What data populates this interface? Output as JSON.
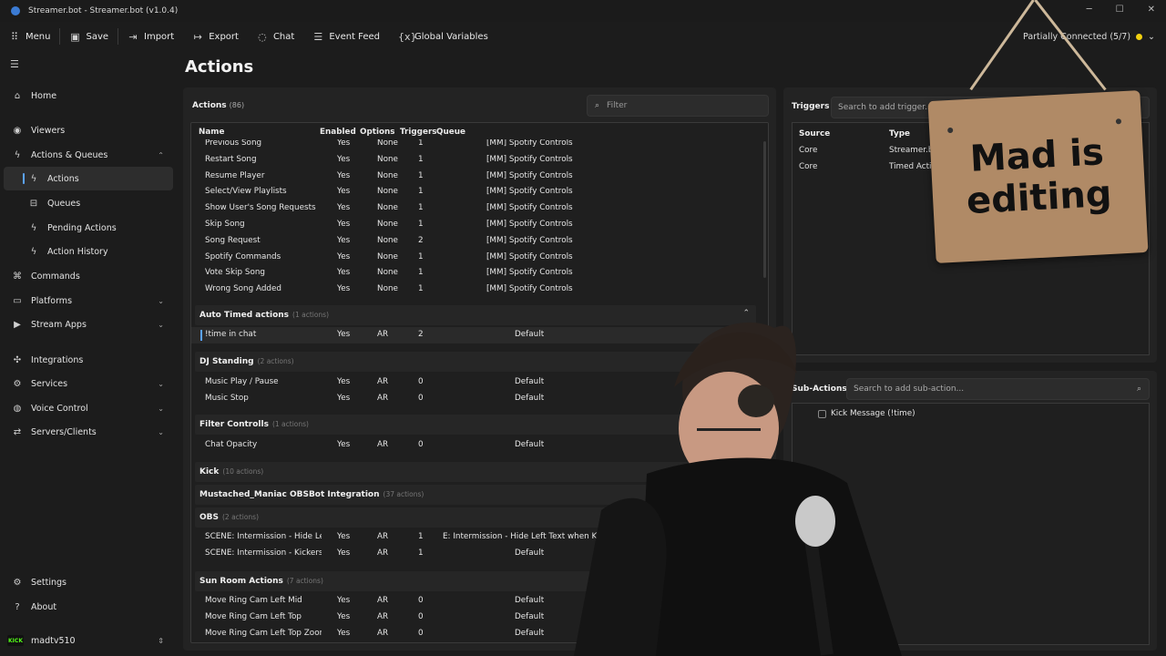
{
  "window": {
    "title": "Streamer.bot - Streamer.bot (v1.0.4)"
  },
  "toolbar": {
    "items": [
      {
        "label": "Menu",
        "icon": "grid-icon"
      },
      {
        "label": "Save",
        "icon": "save-icon"
      },
      {
        "label": "Import",
        "icon": "import-icon"
      },
      {
        "label": "Export",
        "icon": "export-icon"
      },
      {
        "label": "Chat",
        "icon": "chat-icon"
      },
      {
        "label": "Event Feed",
        "icon": "event-feed-icon"
      },
      {
        "label": "Global Variables",
        "icon": "variables-icon"
      }
    ],
    "connection_status": "Partially Connected (5/7)",
    "connection_color": "#f2d00f"
  },
  "sidebar": {
    "items": [
      {
        "label": "Home"
      },
      {
        "label": "Viewers"
      },
      {
        "label": "Actions & Queues"
      },
      {
        "label": "Actions"
      },
      {
        "label": "Queues"
      },
      {
        "label": "Pending Actions"
      },
      {
        "label": "Action History"
      },
      {
        "label": "Commands"
      },
      {
        "label": "Platforms"
      },
      {
        "label": "Stream Apps"
      },
      {
        "label": "Integrations"
      },
      {
        "label": "Services"
      },
      {
        "label": "Voice Control"
      },
      {
        "label": "Servers/Clients"
      },
      {
        "label": "Settings"
      },
      {
        "label": "About"
      }
    ],
    "user": {
      "platform": "KICK",
      "name": "madtv510"
    }
  },
  "page": {
    "title": "Actions"
  },
  "actions": {
    "heading": "Actions",
    "count": "(86)",
    "filter_placeholder": "Filter",
    "columns": [
      "Name",
      "Enabled",
      "Options",
      "Triggers",
      "Queue"
    ],
    "spotify_rows": [
      {
        "name": "Previous Song",
        "enabled": "Yes",
        "options": "None",
        "triggers": "1",
        "queue": "[MM] Spotify Controls"
      },
      {
        "name": "Restart Song",
        "enabled": "Yes",
        "options": "None",
        "triggers": "1",
        "queue": "[MM] Spotify Controls"
      },
      {
        "name": "Resume Player",
        "enabled": "Yes",
        "options": "None",
        "triggers": "1",
        "queue": "[MM] Spotify Controls"
      },
      {
        "name": "Select/View Playlists",
        "enabled": "Yes",
        "options": "None",
        "triggers": "1",
        "queue": "[MM] Spotify Controls"
      },
      {
        "name": "Show User's Song Requests",
        "enabled": "Yes",
        "options": "None",
        "triggers": "1",
        "queue": "[MM] Spotify Controls"
      },
      {
        "name": "Skip Song",
        "enabled": "Yes",
        "options": "None",
        "triggers": "1",
        "queue": "[MM] Spotify Controls"
      },
      {
        "name": "Song Request",
        "enabled": "Yes",
        "options": "None",
        "triggers": "2",
        "queue": "[MM] Spotify Controls"
      },
      {
        "name": "Spotify Commands",
        "enabled": "Yes",
        "options": "None",
        "triggers": "1",
        "queue": "[MM] Spotify Controls"
      },
      {
        "name": "Vote Skip Song",
        "enabled": "Yes",
        "options": "None",
        "triggers": "1",
        "queue": "[MM] Spotify Controls"
      },
      {
        "name": "Wrong Song Added",
        "enabled": "Yes",
        "options": "None",
        "triggers": "1",
        "queue": "[MM] Spotify Controls"
      }
    ],
    "groups": {
      "auto_timed": {
        "name": "Auto Timed actions",
        "count": "(1 actions)"
      },
      "dj_standing": {
        "name": "DJ Standing",
        "count": "(2 actions)"
      },
      "filter_controlls": {
        "name": "Filter Controlls",
        "count": "(1 actions)"
      },
      "kick": {
        "name": "Kick",
        "count": "(10 actions)"
      },
      "obsbot": {
        "name": "Mustached_Maniac OBSBot Integration",
        "count": "(37 actions)"
      },
      "obs": {
        "name": "OBS",
        "count": "(2 actions)"
      },
      "sun_room": {
        "name": "Sun Room Actions",
        "count": "(7 actions)"
      }
    },
    "auto_timed_rows": [
      {
        "name": "!time in chat",
        "enabled": "Yes",
        "options": "AR",
        "triggers": "2",
        "queue": "Default"
      }
    ],
    "dj_rows": [
      {
        "name": "Music Play / Pause",
        "enabled": "Yes",
        "options": "AR",
        "triggers": "0",
        "queue": "Default"
      },
      {
        "name": "Music Stop",
        "enabled": "Yes",
        "options": "AR",
        "triggers": "0",
        "queue": "Default"
      }
    ],
    "filter_rows": [
      {
        "name": "Chat Opacity",
        "enabled": "Yes",
        "options": "AR",
        "triggers": "0",
        "queue": "Default"
      }
    ],
    "obs_rows": [
      {
        "name": "SCENE: Intermission - Hide Lef",
        "enabled": "Yes",
        "options": "AR",
        "triggers": "1",
        "queue": "E: Intermission - Hide Left Text when Kicks do"
      },
      {
        "name": "SCENE: Intermission - Kickers 1",
        "enabled": "Yes",
        "options": "AR",
        "triggers": "1",
        "queue": "Default"
      }
    ],
    "sun_rows": [
      {
        "name": "Move Ring Cam Left Mid",
        "enabled": "Yes",
        "options": "AR",
        "triggers": "0",
        "queue": "Default"
      },
      {
        "name": "Move Ring Cam Left Top",
        "enabled": "Yes",
        "options": "AR",
        "triggers": "0",
        "queue": "Default"
      },
      {
        "name": "Move Ring Cam Left Top Zoom",
        "enabled": "Yes",
        "options": "AR",
        "triggers": "0",
        "queue": "Default"
      }
    ]
  },
  "triggers": {
    "heading": "Triggers",
    "search_placeholder": "Search to add trigger...",
    "columns": [
      "Source",
      "Type"
    ],
    "rows": [
      {
        "source": "Core",
        "type": "Streamer.bo"
      },
      {
        "source": "Core",
        "type": "Timed Actio"
      }
    ]
  },
  "subactions": {
    "heading": "Sub-Actions",
    "search_placeholder": "Search to add sub-action...",
    "items": [
      "Kick Message (!time)"
    ]
  },
  "overlay": {
    "sign_line1": "Mad is",
    "sign_line2": "editing",
    "sign_color": "#b08a66"
  },
  "colors": {
    "accent": "#5ba3ff",
    "background": "#1c1c1c",
    "panel": "#232323"
  }
}
